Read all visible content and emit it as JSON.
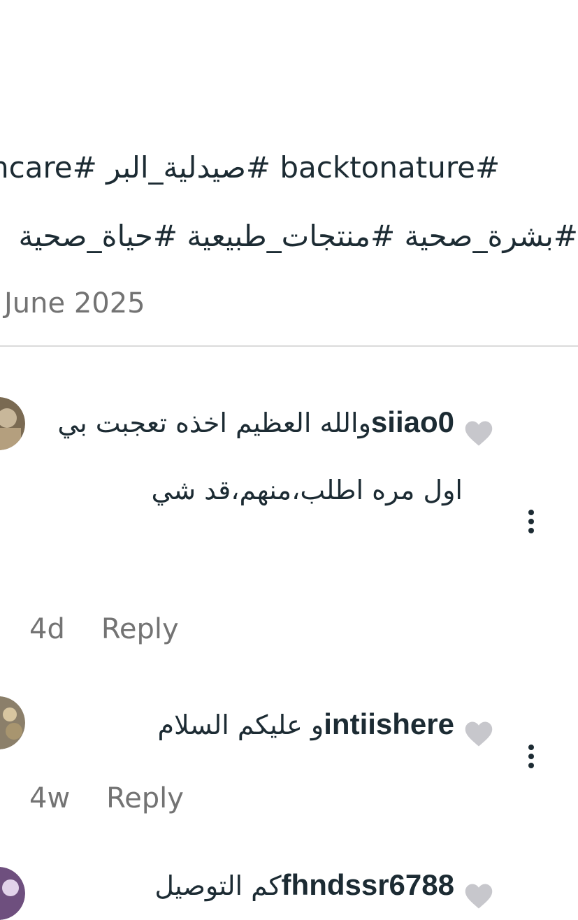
{
  "caption": {
    "line1": "kincare# صيدلية_البر# backtonature#",
    "line2": "#بشرة_صحية #منتجات_طبيعية #حياة_صحية"
  },
  "post_date": "June 2025",
  "comments": [
    {
      "username": "siiao0",
      "text": "والله العظيم اخذه تعجبت بي اول مره اطلب،منهم،قد شي",
      "time": "4d",
      "reply_label": "Reply",
      "avatar_icon": "avatar-photo",
      "like_icon": "heart-icon",
      "more_icon": "more-vertical-icon"
    },
    {
      "username": "intiishere",
      "text": "و عليكم السلام",
      "time": "4w",
      "reply_label": "Reply",
      "avatar_icon": "avatar-photo",
      "like_icon": "heart-icon",
      "more_icon": "more-vertical-icon"
    },
    {
      "username": "fhndssr6788",
      "text": "كم التوصيل",
      "avatar_icon": "avatar-photo",
      "like_icon": "heart-icon"
    }
  ],
  "colors": {
    "text": "#1c2b33",
    "secondary": "#737373",
    "heart": "#c7c7cc",
    "divider": "#dbdbdb"
  }
}
